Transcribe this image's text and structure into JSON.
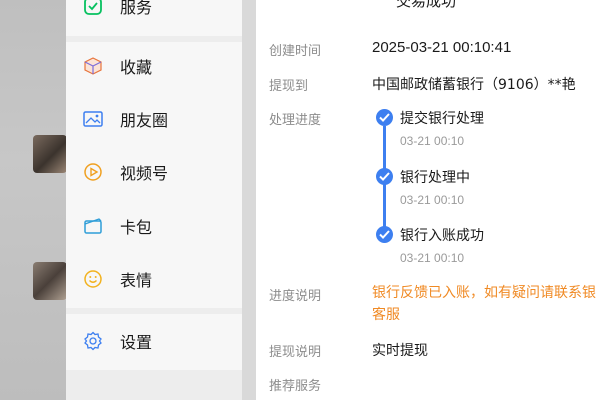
{
  "menu": {
    "items": [
      {
        "label": "服务",
        "icon": "service-icon"
      },
      {
        "label": "收藏",
        "icon": "favorites-icon"
      },
      {
        "label": "朋友圈",
        "icon": "moments-icon"
      },
      {
        "label": "视频号",
        "icon": "channels-icon"
      },
      {
        "label": "卡包",
        "icon": "card-wallet-icon"
      },
      {
        "label": "表情",
        "icon": "stickers-icon"
      },
      {
        "label": "设置",
        "icon": "settings-icon"
      }
    ]
  },
  "detail": {
    "title": "交易成功",
    "created": {
      "label": "创建时间",
      "value": "2025-03-21 00:10:41"
    },
    "withdraw_to": {
      "label": "提现到",
      "value": "中国邮政储蓄银行（9106）**艳"
    },
    "progress": {
      "label": "处理进度",
      "steps": [
        {
          "title": "提交银行处理",
          "time": "03-21 00:10"
        },
        {
          "title": "银行处理中",
          "time": "03-21 00:10"
        },
        {
          "title": "银行入账成功",
          "time": "03-21 00:10"
        }
      ]
    },
    "progress_note": {
      "label": "进度说明",
      "line1": "银行反馈已入账，如有疑问请联系银",
      "line2": "客服"
    },
    "withdraw_note": {
      "label": "提现说明",
      "value": "实时提现"
    },
    "recommend": {
      "label": "推荐服务"
    }
  },
  "colors": {
    "accent": "#3d7ff0",
    "orange": "#f08a24",
    "service_green": "#07c160"
  }
}
